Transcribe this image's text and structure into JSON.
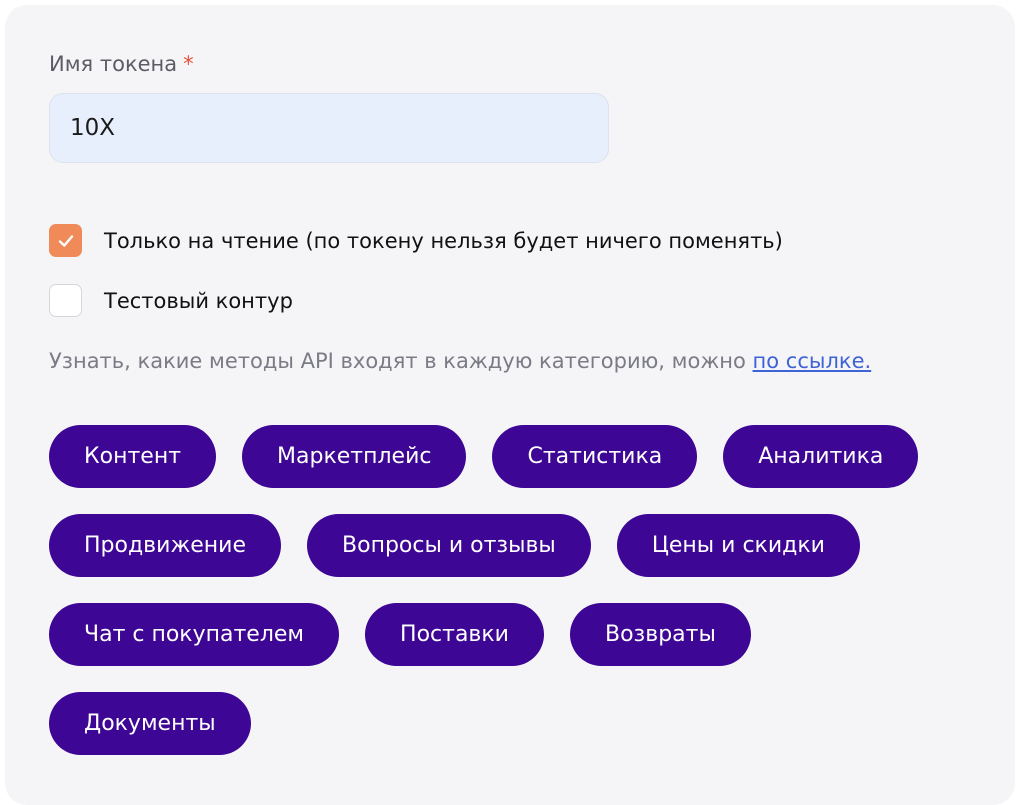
{
  "form": {
    "name_label": "Имя токена",
    "required_mark": "*",
    "name_value": "10X"
  },
  "options": [
    {
      "label": "Только на чтение (по токену нельзя будет ничего поменять)",
      "checked": true
    },
    {
      "label": "Тестовый контур",
      "checked": false
    }
  ],
  "hint": {
    "text": "Узнать, какие методы API входят в каждую категорию, можно",
    "link": "по ссылке."
  },
  "categories": [
    "Контент",
    "Маркетплейс",
    "Статистика",
    "Аналитика",
    "Продвижение",
    "Вопросы и отзывы",
    "Цены и скидки",
    "Чат с покупателем",
    "Поставки",
    "Возвраты",
    "Документы"
  ],
  "colors": {
    "chip_bg": "#3d0694",
    "checkbox_checked": "#f08a58",
    "required": "#e8513a",
    "link": "#3e63d6"
  }
}
